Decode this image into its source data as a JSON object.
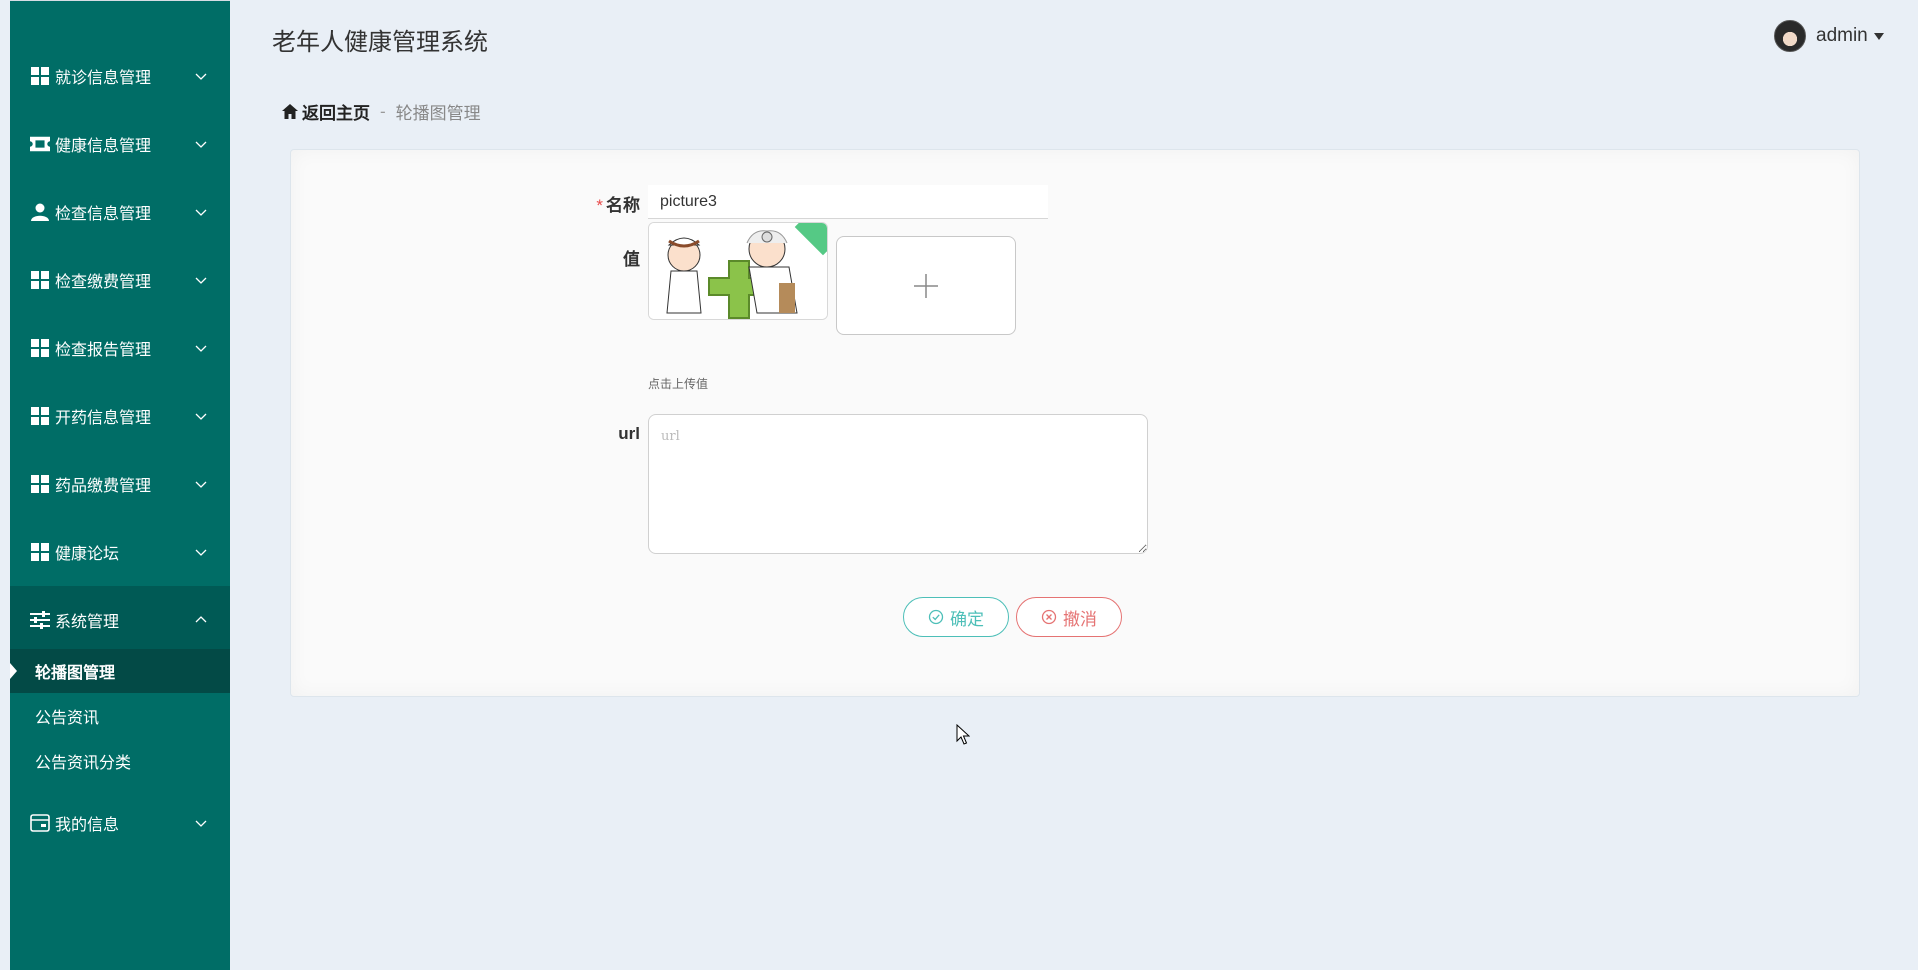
{
  "header": {
    "title": "老年人健康管理系统",
    "username": "admin"
  },
  "sidebar": {
    "menus": [
      {
        "label": "就诊信息管理",
        "icon": "grid-icon"
      },
      {
        "label": "健康信息管理",
        "icon": "ticket-icon"
      },
      {
        "label": "检查信息管理",
        "icon": "user-icon"
      },
      {
        "label": "检查缴费管理",
        "icon": "grid-icon"
      },
      {
        "label": "检查报告管理",
        "icon": "grid-icon"
      },
      {
        "label": "开药信息管理",
        "icon": "grid-icon"
      },
      {
        "label": "药品缴费管理",
        "icon": "grid-icon"
      },
      {
        "label": "健康论坛",
        "icon": "grid-icon"
      },
      {
        "label": "系统管理",
        "icon": "sliders-icon"
      },
      {
        "label": "我的信息",
        "icon": "card-icon"
      }
    ],
    "submenus": [
      {
        "label": "轮播图管理"
      },
      {
        "label": "公告资讯"
      },
      {
        "label": "公告资讯分类"
      }
    ]
  },
  "breadcrumb": {
    "home": "返回主页",
    "separator": "-",
    "current": "轮播图管理"
  },
  "form": {
    "name_label": "名称",
    "required_mark": "*",
    "name_value": "picture3",
    "value_label": "值",
    "upload_tip": "点击上传值",
    "url_label": "url",
    "url_placeholder": "url",
    "confirm_label": "确定",
    "cancel_label": "撤消"
  },
  "colors": {
    "sidebar": "#006d66",
    "accent": "#4dbfb8",
    "danger": "#e57373",
    "background": "#e9eff6"
  }
}
